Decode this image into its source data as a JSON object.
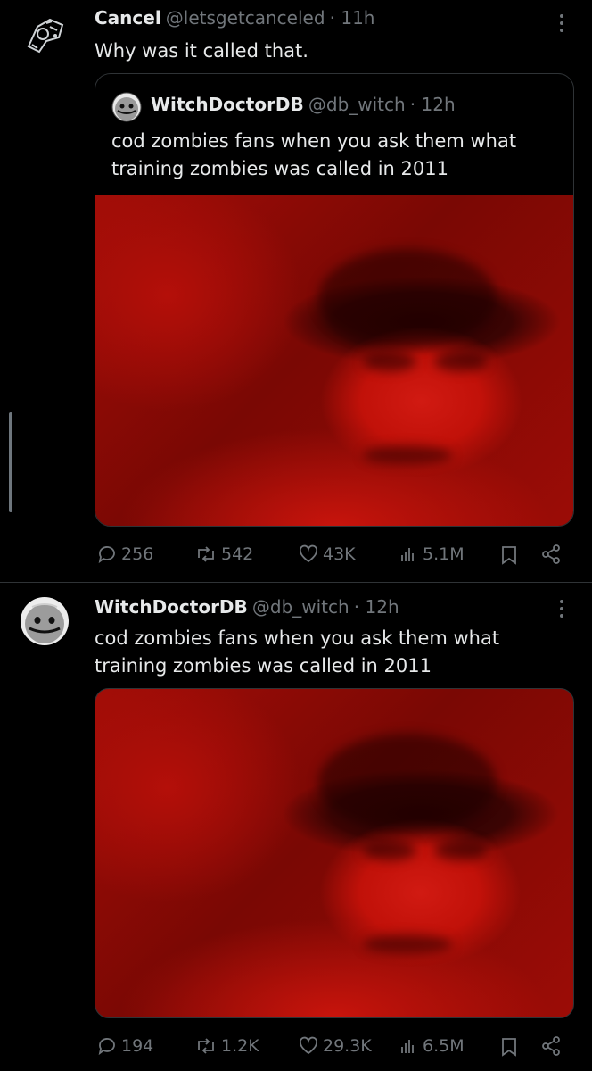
{
  "tweet1": {
    "display_name": "Cancel",
    "handle": "@letsgetcanceled",
    "time": "· 11h",
    "text": "Why was it called that.",
    "quote": {
      "display_name": "WitchDoctorDB",
      "handle": "@db_witch",
      "time": "· 12h",
      "text": "cod zombies fans when you ask them what training zombies was called in 2011"
    },
    "stats": {
      "replies": "256",
      "reposts": "542",
      "likes": "43K",
      "views": "5.1M"
    }
  },
  "tweet2": {
    "display_name": "WitchDoctorDB",
    "handle": "@db_witch",
    "time": "· 12h",
    "text": "cod zombies fans when you ask them what training zombies was called in 2011",
    "stats": {
      "replies": "194",
      "reposts": "1.2K",
      "likes": "29.3K",
      "views": "6.5M"
    }
  },
  "colors": {
    "background": "#000000",
    "text": "#e7e9ea",
    "muted": "#71767b",
    "border": "#2f3336"
  }
}
